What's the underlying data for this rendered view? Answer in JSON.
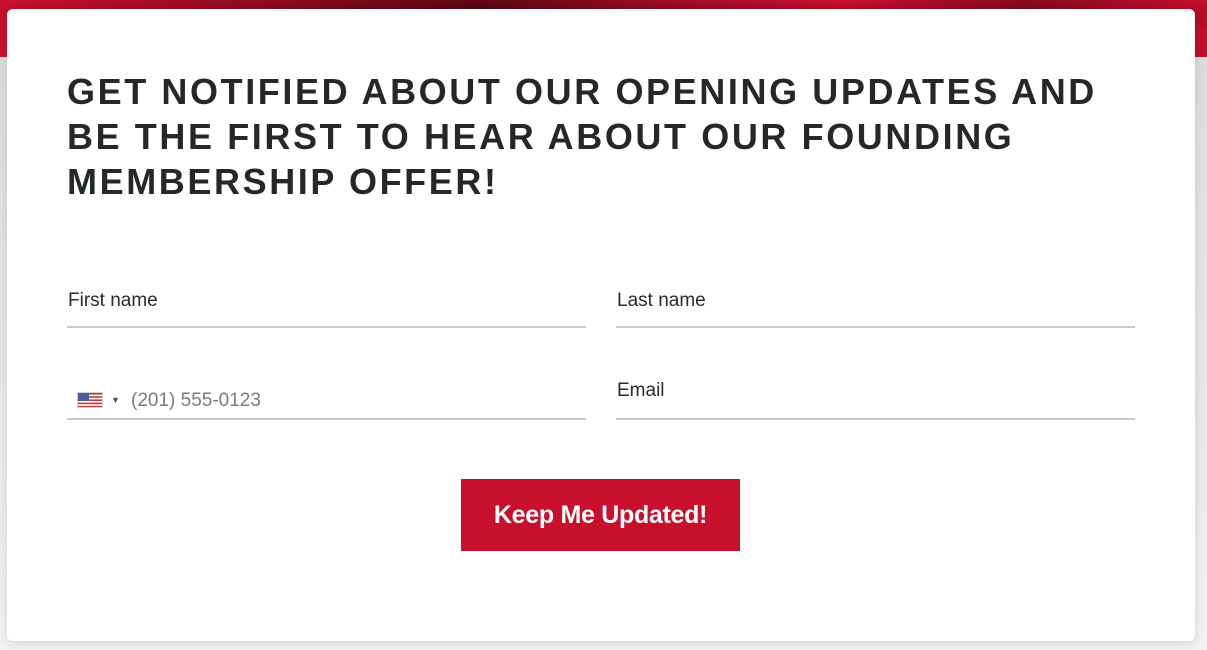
{
  "form": {
    "headline": "GET NOTIFIED ABOUT OUR OPENING UPDATES AND BE THE FIRST TO HEAR ABOUT OUR FOUNDING MEMBERSHIP OFFER!",
    "fields": {
      "first_name_label": "First name",
      "last_name_label": "Last name",
      "email_label": "Email",
      "phone": {
        "country_flag_icon": "us-flag-icon",
        "dropdown_icon": "caret-down-icon",
        "placeholder": "(201) 555-0123",
        "value": ""
      }
    },
    "submit_label": "Keep Me Updated!"
  },
  "colors": {
    "accent": "#c8102e",
    "text_dark": "#24282a",
    "field_border": "#c9c9c9",
    "placeholder": "#777b7e"
  }
}
